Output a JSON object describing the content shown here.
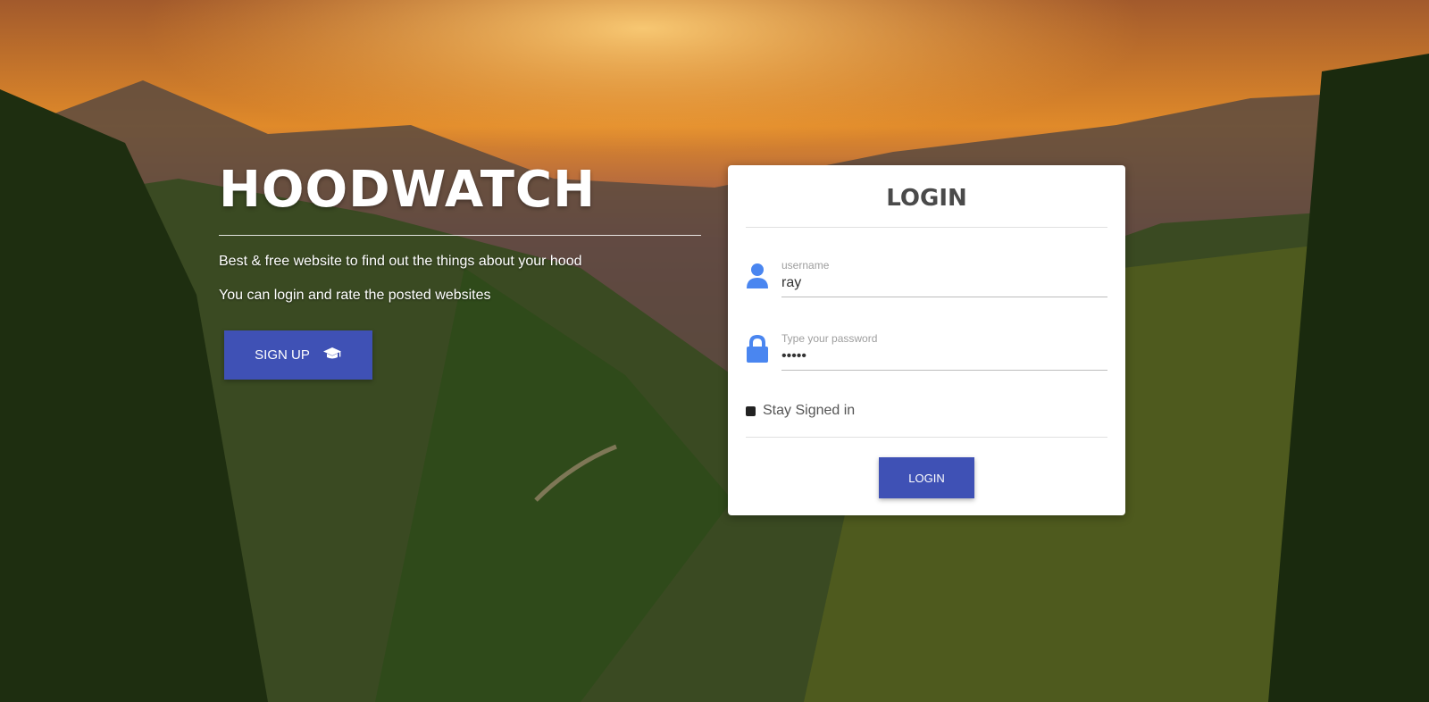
{
  "brand": {
    "title": "HOODWATCH",
    "tagline": "Best & free website to find out the things about your hood",
    "subtext": "You can login and rate the posted websites",
    "signup_label": "SIGN UP",
    "signup_icon": "graduation-cap-icon"
  },
  "login": {
    "heading": "LOGIN",
    "username_label": "username",
    "username_value": "ray",
    "username_icon": "user-icon",
    "password_label": "Type your password",
    "password_value": "•••••",
    "password_icon": "lock-icon",
    "remember_label": "Stay Signed in",
    "submit_label": "LOGIN"
  },
  "colors": {
    "primary": "#3f51b5",
    "icon": "#4a86f0"
  }
}
